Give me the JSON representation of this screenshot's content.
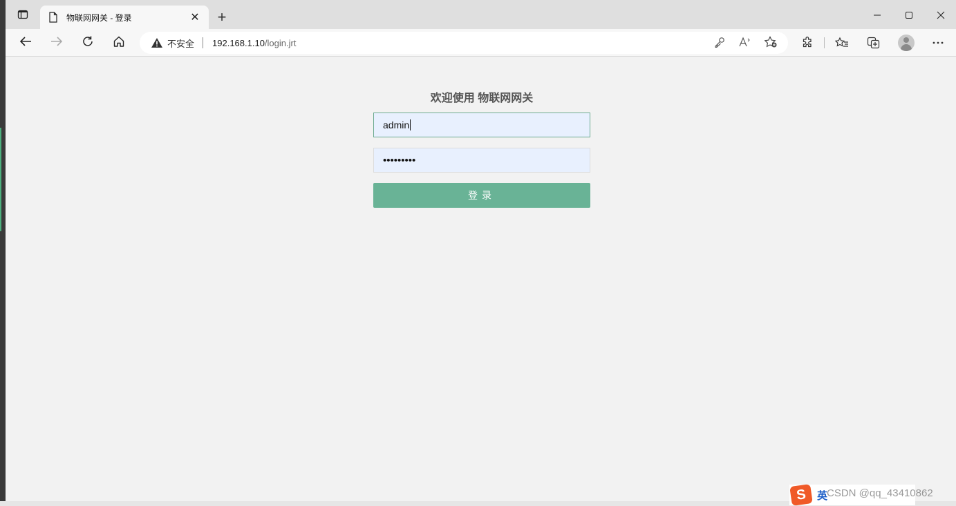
{
  "browser": {
    "tab_title": "物联网网关 - 登录",
    "new_tab_symbol": "+",
    "close_tab_symbol": "✕",
    "security_label": "不安全",
    "url_host": "192.168.1.10",
    "url_path": "/login.jrt"
  },
  "login": {
    "heading": "欢迎使用 物联网网关",
    "username_value": "admin",
    "password_mask": "•••••••••",
    "submit_label": "登录"
  },
  "overlay": {
    "ime_logo": "S",
    "ime_language": "英",
    "watermark": "CSDN @qq_43410862"
  },
  "colors": {
    "accent_button": "#69b396",
    "autofill_field": "#e8f0fe",
    "page_background": "#f2f2f2"
  },
  "icons": [
    "tab-actions-icon",
    "page-icon",
    "back-icon",
    "forward-icon",
    "refresh-icon",
    "home-icon",
    "warning-icon",
    "key-icon",
    "read-aloud-icon",
    "add-favorite-icon",
    "extensions-icon",
    "favorites-icon",
    "collections-icon",
    "profile-icon",
    "more-icon"
  ]
}
